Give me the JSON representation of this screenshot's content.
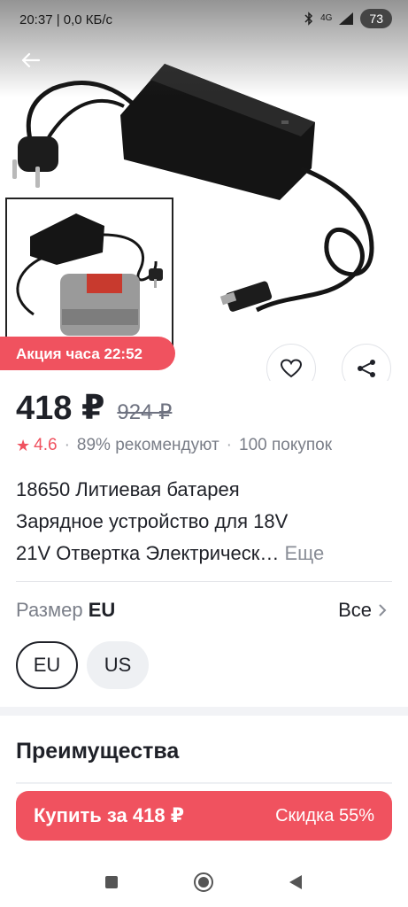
{
  "status_bar": {
    "time_speed": "20:37 | 0,0 КБ/с",
    "network": "4G",
    "battery": "73"
  },
  "hero": {
    "promo_label": "Акция часа 22:52"
  },
  "product": {
    "price": "418 ₽",
    "old_price": "924 ₽",
    "rating": "4.6",
    "recommend": "89% рекомендуют",
    "purchases": "100 покупок",
    "title_lines": [
      "18650 Литиевая батарея",
      "Зарядное устройство для 18V",
      "21V Отвертка Электрическ…"
    ],
    "more_link": "Еще"
  },
  "size": {
    "label": "Размер",
    "selected": "EU",
    "all_link": "Все",
    "options": [
      "EU",
      "US"
    ]
  },
  "sections": {
    "benefits_title": "Преимущества"
  },
  "buy": {
    "label": "Купить за 418 ₽",
    "discount": "Скидка 55%"
  },
  "colors": {
    "accent": "#f0525f",
    "text": "#1f2128",
    "muted": "#7a7e88"
  },
  "icons": [
    "back-arrow-icon",
    "heart-icon",
    "share-icon",
    "star-icon",
    "chevron-right-icon",
    "square-nav-icon",
    "circle-nav-icon",
    "triangle-back-icon",
    "bluetooth-icon",
    "signal-icon"
  ]
}
